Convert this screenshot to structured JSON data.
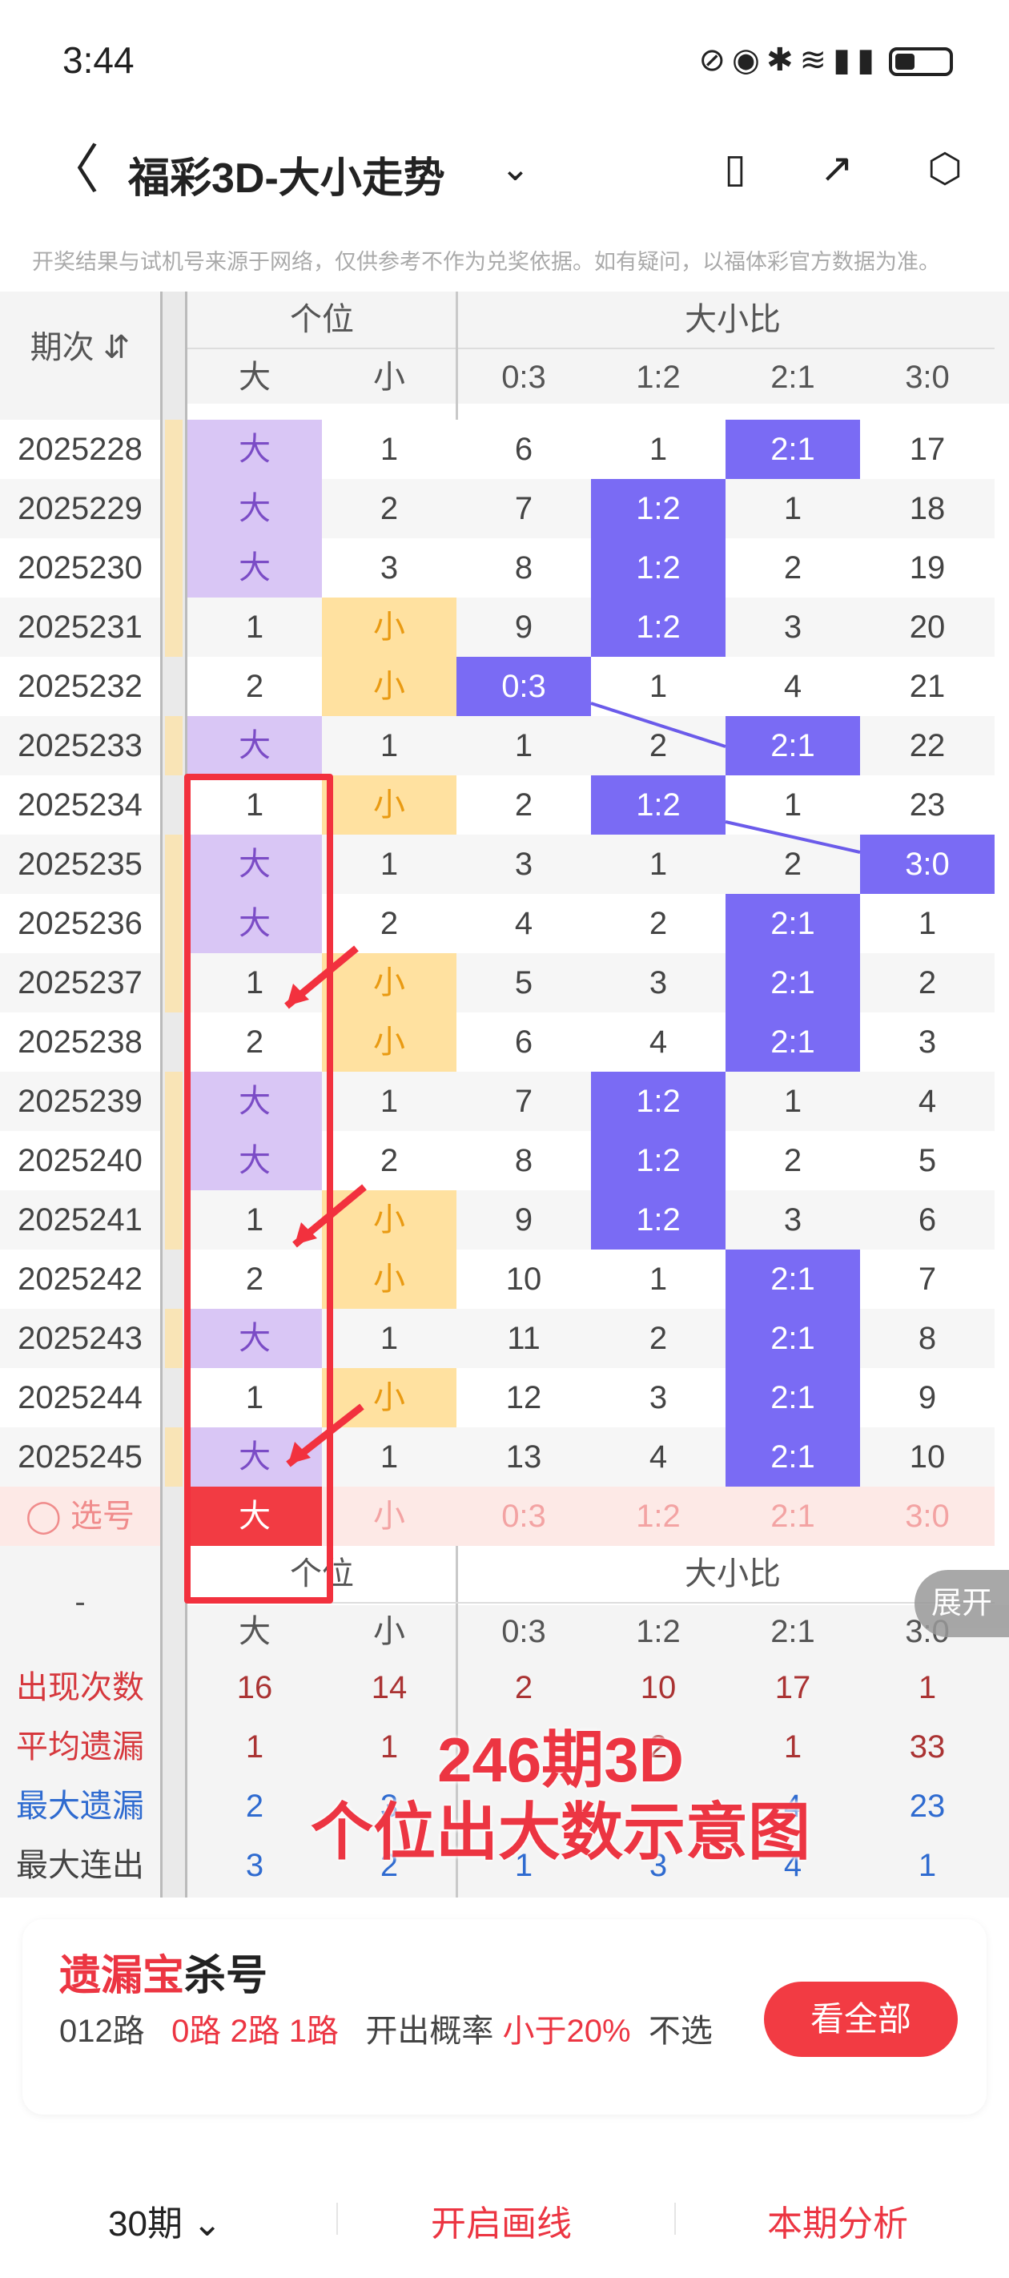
{
  "status": {
    "time": "3:44"
  },
  "header": {
    "title": "福彩3D-大小走势",
    "back": "〈",
    "dropdown": "⌄"
  },
  "disclaimer": "开奖结果与试机号来源于网络，仅供参考不作为兑奖依据。如有疑问，以福体彩官方数据为准。",
  "table": {
    "period_header": "期次",
    "group_geiwei": "个位",
    "group_daxiaobi": "大小比",
    "col_da": "大",
    "col_xiao": "小",
    "ratio_cols": [
      "0:3",
      "1:2",
      "2:1",
      "3:0"
    ],
    "rows": [
      {
        "p": "2025228",
        "a": "大",
        "b": "1",
        "c": [
          "6",
          "1",
          "2:1",
          "17"
        ],
        "ak": "da",
        "bk": "",
        "ck": 2
      },
      {
        "p": "2025229",
        "a": "大",
        "b": "2",
        "c": [
          "7",
          "1:2",
          "1",
          "18"
        ],
        "ak": "da",
        "bk": "",
        "ck": 1
      },
      {
        "p": "2025230",
        "a": "大",
        "b": "3",
        "c": [
          "8",
          "1:2",
          "2",
          "19"
        ],
        "ak": "da",
        "bk": "",
        "ck": 1
      },
      {
        "p": "2025231",
        "a": "1",
        "b": "小",
        "c": [
          "9",
          "1:2",
          "3",
          "20"
        ],
        "ak": "",
        "bk": "xiao",
        "ck": 1
      },
      {
        "p": "2025232",
        "a": "2",
        "b": "小",
        "c": [
          "0:3",
          "1",
          "4",
          "21"
        ],
        "ak": "",
        "bk": "xiao",
        "ck": 0
      },
      {
        "p": "2025233",
        "a": "大",
        "b": "1",
        "c": [
          "1",
          "2",
          "2:1",
          "22"
        ],
        "ak": "da",
        "bk": "",
        "ck": 2
      },
      {
        "p": "2025234",
        "a": "1",
        "b": "小",
        "c": [
          "2",
          "1:2",
          "1",
          "23"
        ],
        "ak": "",
        "bk": "xiao",
        "ck": 1
      },
      {
        "p": "2025235",
        "a": "大",
        "b": "1",
        "c": [
          "3",
          "1",
          "2",
          "3:0"
        ],
        "ak": "da",
        "bk": "",
        "ck": 3
      },
      {
        "p": "2025236",
        "a": "大",
        "b": "2",
        "c": [
          "4",
          "2",
          "2:1",
          "1"
        ],
        "ak": "da",
        "bk": "",
        "ck": 2
      },
      {
        "p": "2025237",
        "a": "1",
        "b": "小",
        "c": [
          "5",
          "3",
          "2:1",
          "2"
        ],
        "ak": "",
        "bk": "xiao",
        "ck": 2
      },
      {
        "p": "2025238",
        "a": "2",
        "b": "小",
        "c": [
          "6",
          "4",
          "2:1",
          "3"
        ],
        "ak": "",
        "bk": "xiao",
        "ck": 2
      },
      {
        "p": "2025239",
        "a": "大",
        "b": "1",
        "c": [
          "7",
          "1:2",
          "1",
          "4"
        ],
        "ak": "da",
        "bk": "",
        "ck": 1
      },
      {
        "p": "2025240",
        "a": "大",
        "b": "2",
        "c": [
          "8",
          "1:2",
          "2",
          "5"
        ],
        "ak": "da",
        "bk": "",
        "ck": 1
      },
      {
        "p": "2025241",
        "a": "1",
        "b": "小",
        "c": [
          "9",
          "1:2",
          "3",
          "6"
        ],
        "ak": "",
        "bk": "xiao",
        "ck": 1
      },
      {
        "p": "2025242",
        "a": "2",
        "b": "小",
        "c": [
          "10",
          "1",
          "2:1",
          "7"
        ],
        "ak": "",
        "bk": "xiao",
        "ck": 2
      },
      {
        "p": "2025243",
        "a": "大",
        "b": "1",
        "c": [
          "11",
          "2",
          "2:1",
          "8"
        ],
        "ak": "da",
        "bk": "",
        "ck": 2
      },
      {
        "p": "2025244",
        "a": "1",
        "b": "小",
        "c": [
          "12",
          "3",
          "2:1",
          "9"
        ],
        "ak": "",
        "bk": "xiao",
        "ck": 2
      },
      {
        "p": "2025245",
        "a": "大",
        "b": "1",
        "c": [
          "13",
          "4",
          "2:1",
          "10"
        ],
        "ak": "da",
        "bk": "",
        "ck": 2
      }
    ],
    "select_label": "选号",
    "select_row": {
      "a": "大",
      "b": "小",
      "c": [
        "0:3",
        "1:2",
        "2:1",
        "3:0"
      ]
    },
    "footer_dash": "-",
    "stats": [
      {
        "label": "出现次数",
        "color": "#d6383d",
        "vals": [
          "16",
          "14",
          "2",
          "10",
          "17",
          "1"
        ],
        "vcolor": "#a33"
      },
      {
        "label": "平均遗漏",
        "color": "#d6383d",
        "vals": [
          "1",
          "1",
          "",
          "2",
          "1",
          "33"
        ],
        "vcolor": "#a33"
      },
      {
        "label": "最大遗漏",
        "color": "#2f6bd0",
        "vals": [
          "2",
          "3",
          "",
          "",
          "4",
          "23"
        ],
        "vcolor": "#2f6bd0"
      },
      {
        "label": "最大连出",
        "color": "#444",
        "vals": [
          "3",
          "2",
          "1",
          "3",
          "4",
          "1"
        ],
        "vcolor": "#2f6bd0"
      }
    ],
    "expand": "展开"
  },
  "annotation": {
    "line1": "246期3D",
    "line2": "个位出大数示意图"
  },
  "card": {
    "title_red": "遗漏宝",
    "title_black": "杀号",
    "route_label": "012路",
    "routes": "0路 2路 1路",
    "prob_label": "开出概率",
    "prob_value": "小于20%",
    "no_select": "不选",
    "button": "看全部"
  },
  "bottom": {
    "period": "30期",
    "draw": "开启画线",
    "analysis": "本期分析"
  }
}
